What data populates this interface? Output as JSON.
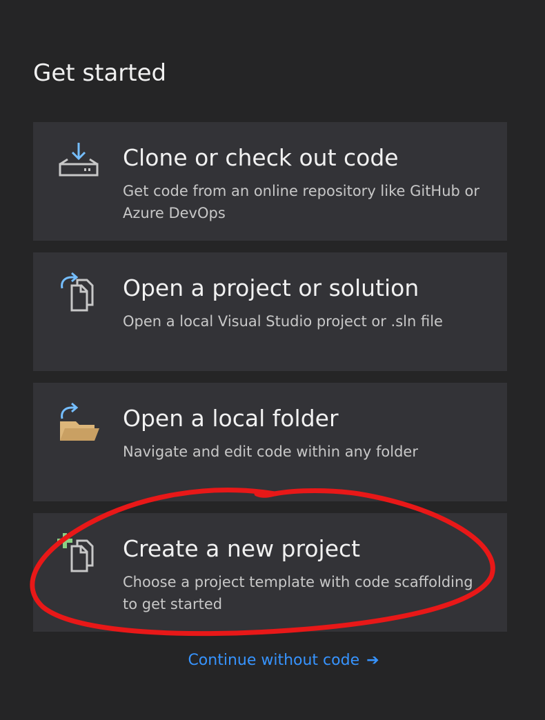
{
  "heading": "Get started",
  "cards": [
    {
      "title": "Clone or check out code",
      "description": "Get code from an online repository like GitHub or Azure DevOps",
      "icon": "download-drive-icon"
    },
    {
      "title": "Open a project or solution",
      "description": "Open a local Visual Studio project or .sln file",
      "icon": "open-project-icon"
    },
    {
      "title": "Open a local folder",
      "description": "Navigate and edit code within any folder",
      "icon": "open-folder-icon"
    },
    {
      "title": "Create a new project",
      "description": "Choose a project template with code scaffolding to get started",
      "icon": "new-project-icon"
    }
  ],
  "continue_link": {
    "label": "Continue without code",
    "arrow": "➔"
  },
  "colors": {
    "background": "#252526",
    "card": "#333337",
    "link": "#3794ff",
    "icon_accent_blue": "#75beff",
    "icon_accent_green": "#89d185",
    "folder": "#dcb67a",
    "annotation_red": "#e81818"
  }
}
